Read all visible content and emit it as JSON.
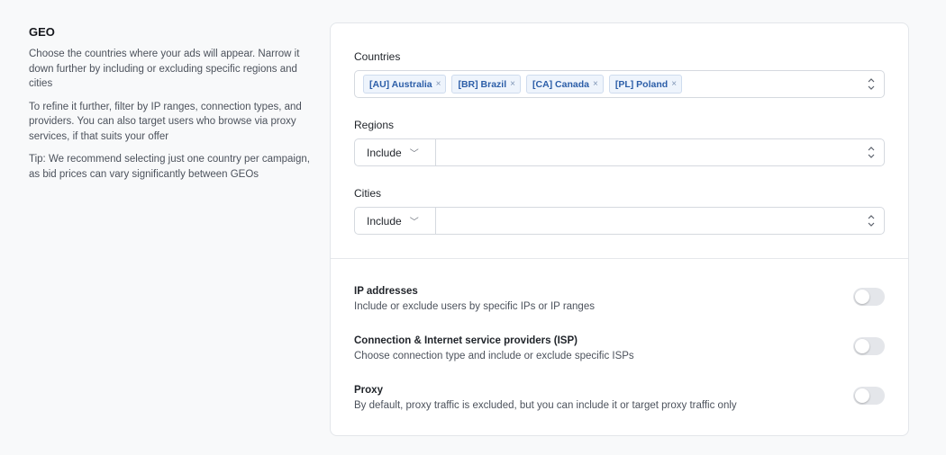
{
  "geo": {
    "title": "GEO",
    "desc1": "Choose the countries where your ads will appear. Narrow it down further by including or excluding specific regions and cities",
    "desc2": "To refine it further, filter by IP ranges, connection types, and providers. You can also target users who browse via proxy services, if that suits your offer",
    "tip": "Tip: We recommend selecting just one country per campaign, as bid prices can vary significantly between GEOs"
  },
  "countries": {
    "label": "Countries",
    "selected": [
      "[AU] Australia",
      "[BR] Brazil",
      "[CA] Canada",
      "[PL] Poland"
    ],
    "remove_glyph": "×"
  },
  "regions": {
    "label": "Regions",
    "mode": "Include",
    "value": ""
  },
  "cities": {
    "label": "Cities",
    "mode": "Include",
    "value": ""
  },
  "toggles": [
    {
      "title": "IP addresses",
      "desc": "Include or exclude users by specific IPs or IP ranges",
      "on": false
    },
    {
      "title": "Connection & Internet service providers (ISP)",
      "desc": "Choose connection type and include or exclude specific ISPs",
      "on": false
    },
    {
      "title": "Proxy",
      "desc": "By default, proxy traffic is excluded, but you can include it or target proxy traffic only",
      "on": false
    }
  ],
  "icons": {
    "select_caret": "chevron-up-down-icon",
    "mode_caret": "chevron-down-icon",
    "mode_caret_glyph": "﹀"
  },
  "colors": {
    "tag_bg": "#eef4fc",
    "tag_text": "#2c5ea8",
    "switch_off": "#e4e6ea"
  }
}
